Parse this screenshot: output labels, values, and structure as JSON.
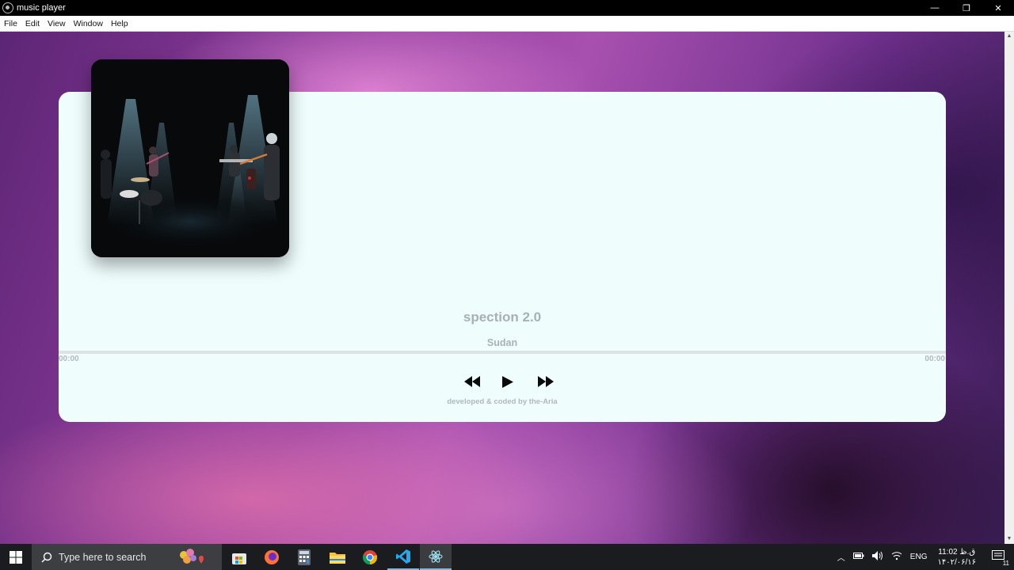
{
  "window": {
    "title": "music player",
    "controls": {
      "minimize": "—",
      "restore": "❐",
      "close": "✕"
    }
  },
  "menu": [
    "File",
    "Edit",
    "View",
    "Window",
    "Help"
  ],
  "player": {
    "song_title": "spection 2.0",
    "artist": "Sudan",
    "time_current": "00:00",
    "time_total": "00:00",
    "progress": 0,
    "footer": "developed & coded by the-Aria",
    "card_bg": "#effdfd",
    "text_color": "#a7b0b7"
  },
  "taskbar": {
    "search_placeholder": "Type here to search",
    "apps": [
      "windows-store-icon",
      "firefox-icon",
      "calculator-icon",
      "file-explorer-icon",
      "chrome-icon",
      "vscode-icon",
      "electron-app-icon"
    ],
    "tray": {
      "language": "ENG",
      "time": "11:02 ق.ظ",
      "date": "۱۴۰۲/۰۶/۱۶",
      "notification_count": "11"
    }
  }
}
